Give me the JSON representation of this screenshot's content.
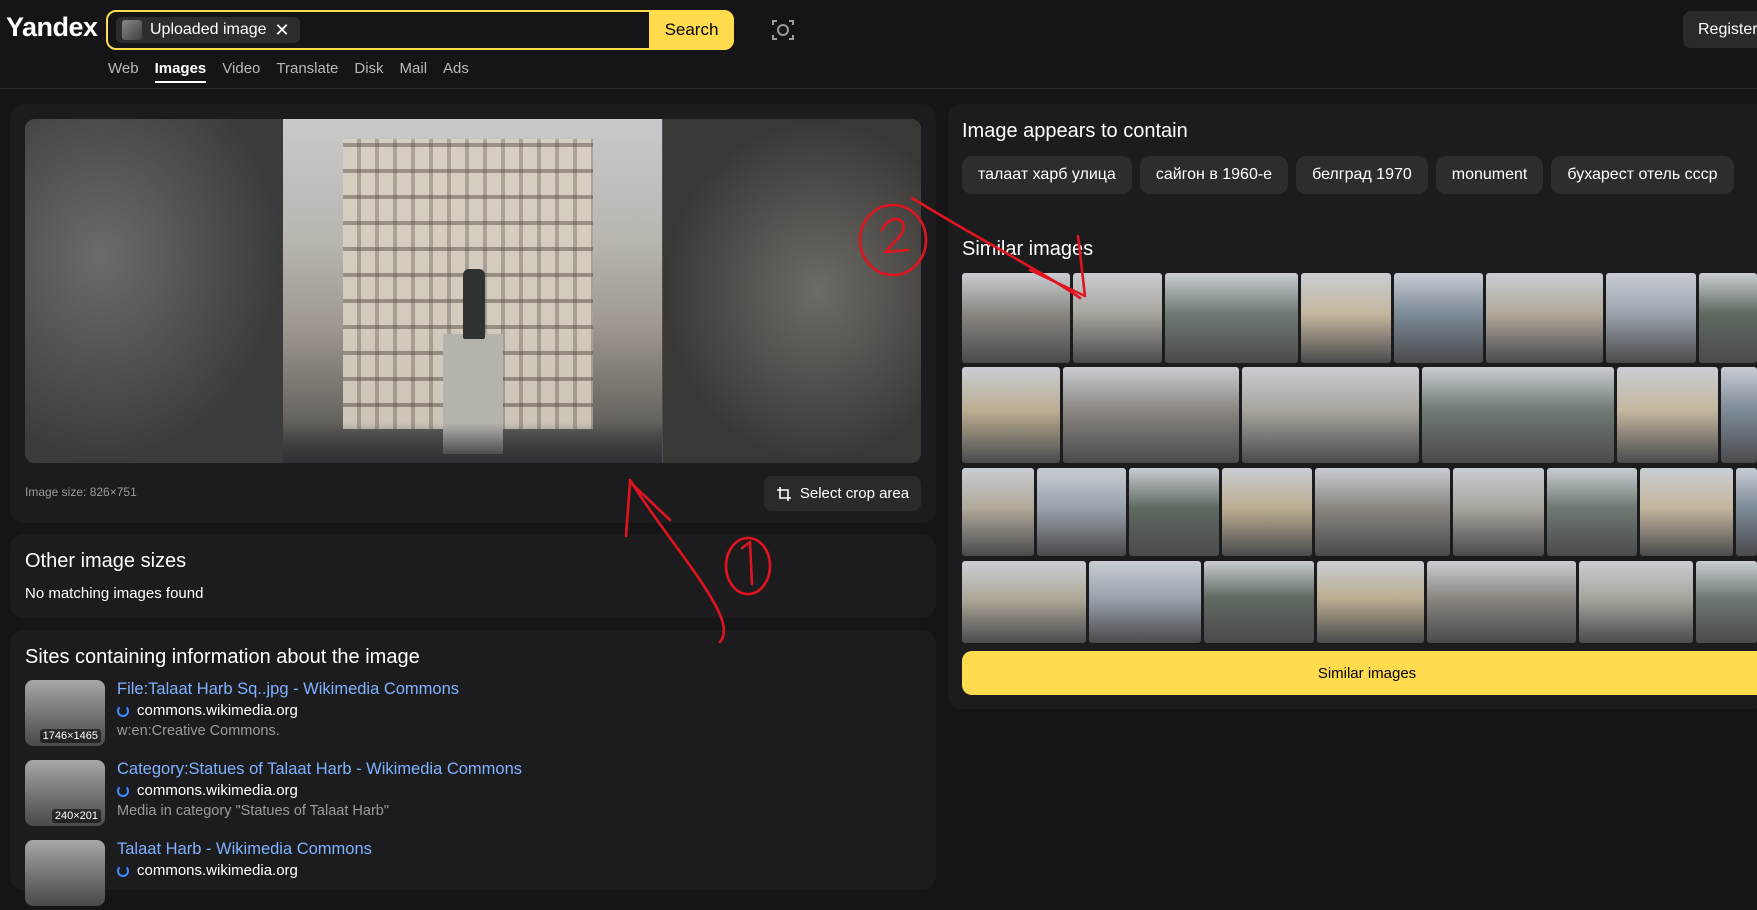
{
  "header": {
    "logo": "Yandex",
    "search_chip_label": "Uploaded image",
    "search_chip_close": "✕",
    "search_button": "Search",
    "register_button": "Register"
  },
  "nav": [
    "Web",
    "Images",
    "Video",
    "Translate",
    "Disk",
    "Mail",
    "Ads"
  ],
  "nav_active": "Images",
  "main": {
    "image_size": "Image size: 826×751",
    "crop_button": "Select crop area",
    "other_sizes_title": "Other image sizes",
    "other_sizes_text": "No matching images found",
    "sites_title": "Sites containing information about the image",
    "sites": [
      {
        "title": "File:Talaat Harb Sq..jpg - Wikimedia Commons",
        "domain": "commons.wikimedia.org",
        "snippet": "w:en:Creative Commons.",
        "dims": "1746×1465"
      },
      {
        "title": "Category:Statues of Talaat Harb - Wikimedia Commons",
        "domain": "commons.wikimedia.org",
        "snippet": "Media in category \"Statues of Talaat Harb\"",
        "dims": "240×201"
      },
      {
        "title": "Talaat Harb - Wikimedia Commons",
        "domain": "commons.wikimedia.org",
        "snippet": "",
        "dims": ""
      }
    ]
  },
  "right": {
    "contain_title": "Image appears to contain",
    "tags": [
      "талаат харб улица",
      "сайгон в 1960-е",
      "белград 1970",
      "monument",
      "бухарест отель ссср"
    ],
    "similar_title": "Similar images",
    "similar_button": "Similar images"
  },
  "annotations": {
    "label_1": "1",
    "label_2": "2",
    "color": "#e0141e"
  },
  "colors": {
    "accent": "#ffdb4d",
    "link": "#7fb2ff",
    "background": "#151517",
    "panel": "#1c1c1f"
  }
}
